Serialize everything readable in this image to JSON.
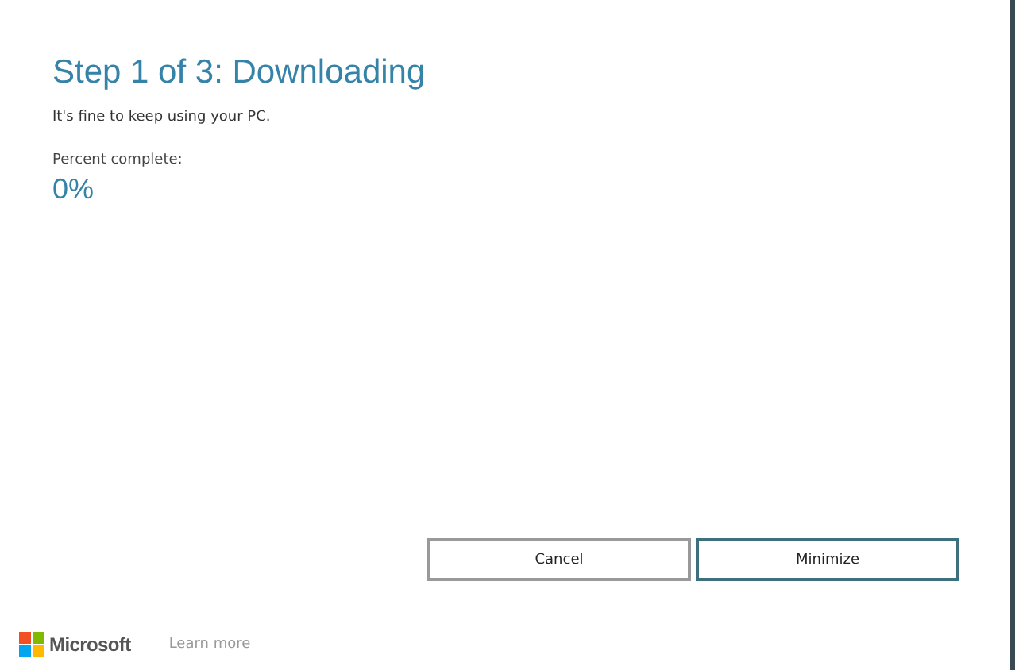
{
  "heading": "Step 1 of 3: Downloading",
  "message": "It's fine to keep using your PC.",
  "progress": {
    "label": "Percent complete:",
    "value": "0%"
  },
  "buttons": [
    {
      "label": "Cancel",
      "focused": false
    },
    {
      "label": "Minimize",
      "focused": true
    }
  ],
  "footer": {
    "brand": "Microsoft",
    "link": "Learn more"
  }
}
